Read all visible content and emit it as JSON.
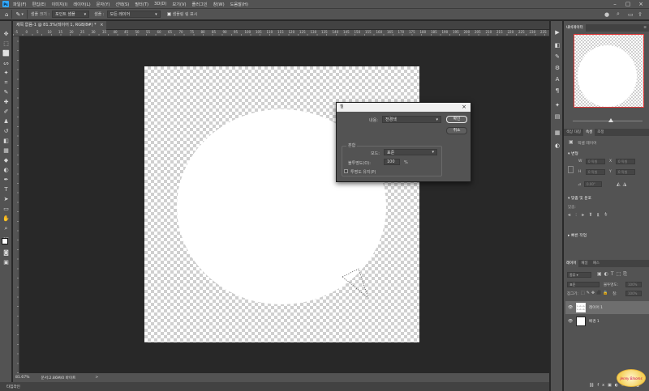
{
  "menubar": {
    "items": [
      "파일(F)",
      "편집(E)",
      "이미지(I)",
      "레이어(L)",
      "문자(Y)",
      "선택(S)",
      "필터(T)",
      "3D(D)",
      "보기(V)",
      "플러그인",
      "창(W)",
      "도움말(H)"
    ]
  },
  "options": {
    "sample_size_label": "샘플 크기 :",
    "sample_size_value": "포인트 샘플",
    "sample_label": "샘플 :",
    "sample_value": "모든 레이어",
    "show_ring_label": "샘플링 링 표시"
  },
  "document_tab": {
    "title": "제목 없음-1 @ 81.3%(레이어 1, RGB/8#) *",
    "close": "×"
  },
  "ruler_numbers": [
    "-5",
    "0",
    "5",
    "10",
    "15",
    "20",
    "25",
    "30",
    "35",
    "40",
    "45",
    "50",
    "55",
    "60",
    "65",
    "70",
    "75",
    "80",
    "85",
    "90",
    "95",
    "100",
    "105",
    "110",
    "115",
    "120",
    "125",
    "130",
    "135",
    "140",
    "145",
    "150",
    "155",
    "160",
    "165",
    "170",
    "175",
    "180",
    "185",
    "190",
    "195",
    "200",
    "205",
    "210",
    "215",
    "220",
    "225",
    "230",
    "235",
    "240"
  ],
  "status": {
    "zoom": "81.67%",
    "doc_info": "문서:2.86M/0 바이트",
    "arrow": ">"
  },
  "bottom_tab": {
    "label": "타임라인"
  },
  "dialog": {
    "title": "칠",
    "close": "×",
    "content_label": "내용:",
    "content_value": "전경색",
    "ok": "확인",
    "cancel": "취소",
    "blend_group_label": "혼합",
    "mode_label": "모드:",
    "mode_value": "표준",
    "opacity_label": "불투명도(O):",
    "opacity_value": "100",
    "opacity_unit": "%",
    "preserve_label": "투명도 유지(P)"
  },
  "navigator": {
    "tabs": [
      "내비게이터"
    ],
    "menu": "≡"
  },
  "properties": {
    "tabs": [
      "색상 대칭",
      "속성",
      "조정"
    ],
    "pixel_layer": "픽셀 레이어",
    "transform_title": "변형",
    "w_label": "W",
    "h_label": "H",
    "x_label": "X",
    "y_label": "Y",
    "w_value": "0 픽셀",
    "h_value": "0 픽셀",
    "x_value": "0 픽셀",
    "y_value": "0 픽셀",
    "angle_value": "0.00°",
    "align_title": "맞춤 및 분포",
    "align_label": "맞춤:",
    "quick_title": "빠른 작업"
  },
  "layers": {
    "tabs": [
      "레이어",
      "채널",
      "패스"
    ],
    "filter_label": "종류",
    "blend_mode": "표준",
    "opacity_label": "불투명도:",
    "opacity_value": "100%",
    "lock_label": "잠그기:",
    "fill_label": "칠:",
    "fill_value": "100%",
    "items": [
      {
        "name": "레이어 1"
      },
      {
        "name": "배경 1"
      }
    ]
  },
  "watermark": {
    "text": "Jenny Blooms"
  },
  "colors": {
    "ui_bg": "#535353",
    "canvas_bg": "#282828",
    "accent": "#31a8ff",
    "nav_frame": "#e23b3b"
  }
}
